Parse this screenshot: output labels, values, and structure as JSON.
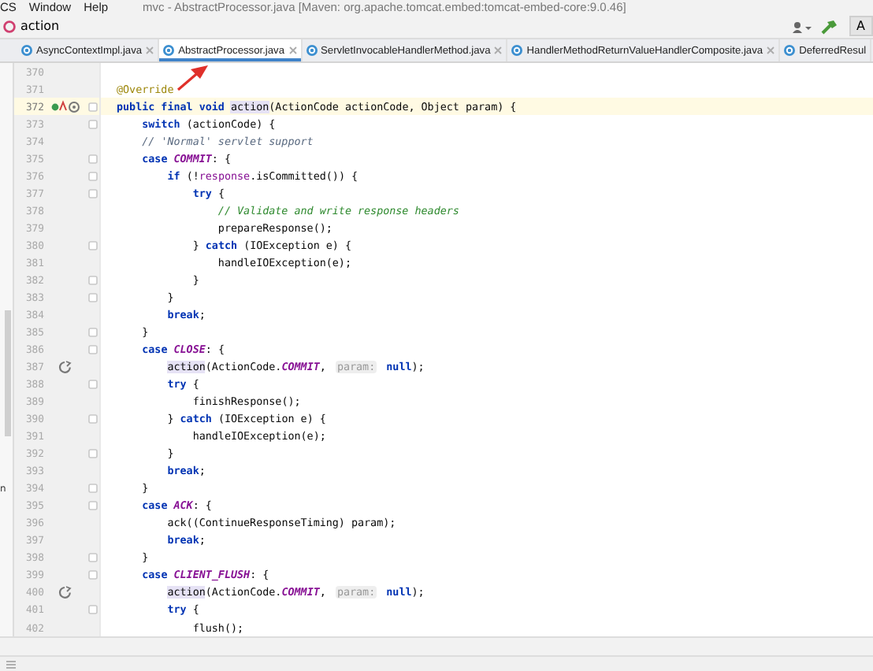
{
  "menu_bar": {
    "items": [
      "CS",
      "Window",
      "Help"
    ],
    "title": "mvc - AbstractProcessor.java [Maven: org.apache.tomcat.embed:tomcat-embed-core:9.0.46]"
  },
  "nav_bar": {
    "breadcrumb": "action",
    "run_button": "A"
  },
  "tabs": [
    {
      "label": "AsyncContextImpl.java",
      "selected": false
    },
    {
      "label": "AbstractProcessor.java",
      "selected": true
    },
    {
      "label": "ServletInvocableHandlerMethod.java",
      "selected": false
    },
    {
      "label": "HandlerMethodReturnValueHandlerComposite.java",
      "selected": false
    },
    {
      "label": "DeferredResul",
      "selected": false
    }
  ],
  "side_panel": {
    "text": "n"
  },
  "editor": {
    "lines": [
      {
        "number": "370",
        "current": false,
        "fold": false
      },
      {
        "number": "371",
        "current": false,
        "fold": false,
        "tokens": [
          {
            "kind": "annotation",
            "text": "@Override"
          }
        ]
      },
      {
        "number": "372",
        "current": true,
        "fold": true,
        "marker": {
          "kind": "override"
        },
        "tokens": [
          {
            "kind": "keyword",
            "text": "public final void "
          },
          {
            "kind": "usage",
            "text": "action"
          },
          {
            "kind": "plain",
            "text": "(ActionCode actionCode, Object param) {"
          }
        ]
      },
      {
        "number": "373",
        "current": false,
        "fold": true,
        "tokens": [
          {
            "kind": "keyword",
            "text": "    switch"
          },
          {
            "kind": "plain",
            "text": " (actionCode) {"
          }
        ]
      },
      {
        "number": "374",
        "current": false,
        "fold": false,
        "tokens": [
          {
            "kind": "comment",
            "text": "    // 'Normal' servlet support"
          }
        ]
      },
      {
        "number": "375",
        "current": false,
        "fold": true,
        "tokens": [
          {
            "kind": "keyword",
            "text": "    case "
          },
          {
            "kind": "constant",
            "text": "COMMIT"
          },
          {
            "kind": "plain",
            "text": ": {"
          }
        ]
      },
      {
        "number": "376",
        "current": false,
        "fold": true,
        "tokens": [
          {
            "kind": "keyword",
            "text": "        if "
          },
          {
            "kind": "plain",
            "text": "(!"
          },
          {
            "kind": "field",
            "text": "response"
          },
          {
            "kind": "plain",
            "text": ".isCommitted()) {"
          }
        ]
      },
      {
        "number": "377",
        "current": false,
        "fold": true,
        "tokens": [
          {
            "kind": "keyword",
            "text": "            try"
          },
          {
            "kind": "plain",
            "text": " {"
          }
        ]
      },
      {
        "number": "378",
        "current": false,
        "fold": false,
        "tokens": [
          {
            "kind": "doc-comment",
            "text": "                // Validate and write response headers"
          }
        ]
      },
      {
        "number": "379",
        "current": false,
        "fold": false,
        "tokens": [
          {
            "kind": "plain",
            "text": "                prepareResponse();"
          }
        ]
      },
      {
        "number": "380",
        "current": false,
        "fold": true,
        "tokens": [
          {
            "kind": "plain",
            "text": "            } "
          },
          {
            "kind": "keyword",
            "text": "catch"
          },
          {
            "kind": "plain",
            "text": " (IOException e) {"
          }
        ]
      },
      {
        "number": "381",
        "current": false,
        "fold": false,
        "tokens": [
          {
            "kind": "plain",
            "text": "                handleIOException(e);"
          }
        ]
      },
      {
        "number": "382",
        "current": false,
        "fold": true,
        "tokens": [
          {
            "kind": "plain",
            "text": "            }"
          }
        ]
      },
      {
        "number": "383",
        "current": false,
        "fold": true,
        "tokens": [
          {
            "kind": "plain",
            "text": "        }"
          }
        ]
      },
      {
        "number": "384",
        "current": false,
        "fold": false,
        "tokens": [
          {
            "kind": "keyword",
            "text": "        break"
          },
          {
            "kind": "plain",
            "text": ";"
          }
        ]
      },
      {
        "number": "385",
        "current": false,
        "fold": true,
        "tokens": [
          {
            "kind": "plain",
            "text": "    }"
          }
        ]
      },
      {
        "number": "386",
        "current": false,
        "fold": true,
        "tokens": [
          {
            "kind": "keyword",
            "text": "    case "
          },
          {
            "kind": "constant",
            "text": "CLOSE"
          },
          {
            "kind": "plain",
            "text": ": {"
          }
        ]
      },
      {
        "number": "387",
        "current": false,
        "fold": false,
        "marker": {
          "kind": "recursion"
        },
        "tokens": [
          {
            "kind": "usage",
            "text": "        action"
          },
          {
            "kind": "plain",
            "text": "(ActionCode."
          },
          {
            "kind": "constant",
            "text": "COMMIT"
          },
          {
            "kind": "plain",
            "text": ", "
          },
          {
            "kind": "hint",
            "text": "param:"
          },
          {
            "kind": "keyword",
            "text": " null"
          },
          {
            "kind": "plain",
            "text": ");"
          }
        ]
      },
      {
        "number": "388",
        "current": false,
        "fold": true,
        "tokens": [
          {
            "kind": "keyword",
            "text": "        try"
          },
          {
            "kind": "plain",
            "text": " {"
          }
        ]
      },
      {
        "number": "389",
        "current": false,
        "fold": false,
        "tokens": [
          {
            "kind": "plain",
            "text": "            finishResponse();"
          }
        ]
      },
      {
        "number": "390",
        "current": false,
        "fold": true,
        "tokens": [
          {
            "kind": "plain",
            "text": "        } "
          },
          {
            "kind": "keyword",
            "text": "catch"
          },
          {
            "kind": "plain",
            "text": " (IOException e) {"
          }
        ]
      },
      {
        "number": "391",
        "current": false,
        "fold": false,
        "tokens": [
          {
            "kind": "plain",
            "text": "            handleIOException(e);"
          }
        ]
      },
      {
        "number": "392",
        "current": false,
        "fold": true,
        "tokens": [
          {
            "kind": "plain",
            "text": "        }"
          }
        ]
      },
      {
        "number": "393",
        "current": false,
        "fold": false,
        "tokens": [
          {
            "kind": "keyword",
            "text": "        break"
          },
          {
            "kind": "plain",
            "text": ";"
          }
        ]
      },
      {
        "number": "394",
        "current": false,
        "fold": true,
        "tokens": [
          {
            "kind": "plain",
            "text": "    }"
          }
        ]
      },
      {
        "number": "395",
        "current": false,
        "fold": true,
        "tokens": [
          {
            "kind": "keyword",
            "text": "    case "
          },
          {
            "kind": "constant",
            "text": "ACK"
          },
          {
            "kind": "plain",
            "text": ": {"
          }
        ]
      },
      {
        "number": "396",
        "current": false,
        "fold": false,
        "tokens": [
          {
            "kind": "plain",
            "text": "        ack((ContinueResponseTiming) param);"
          }
        ]
      },
      {
        "number": "397",
        "current": false,
        "fold": false,
        "tokens": [
          {
            "kind": "keyword",
            "text": "        break"
          },
          {
            "kind": "plain",
            "text": ";"
          }
        ]
      },
      {
        "number": "398",
        "current": false,
        "fold": true,
        "tokens": [
          {
            "kind": "plain",
            "text": "    }"
          }
        ]
      },
      {
        "number": "399",
        "current": false,
        "fold": true,
        "tokens": [
          {
            "kind": "keyword",
            "text": "    case "
          },
          {
            "kind": "constant",
            "text": "CLIENT_FLUSH"
          },
          {
            "kind": "plain",
            "text": ": {"
          }
        ]
      },
      {
        "number": "400",
        "current": false,
        "fold": false,
        "marker": {
          "kind": "recursion"
        },
        "tokens": [
          {
            "kind": "usage",
            "text": "        action"
          },
          {
            "kind": "plain",
            "text": "(ActionCode."
          },
          {
            "kind": "constant",
            "text": "COMMIT"
          },
          {
            "kind": "plain",
            "text": ", "
          },
          {
            "kind": "hint",
            "text": "param:"
          },
          {
            "kind": "keyword",
            "text": " null"
          },
          {
            "kind": "plain",
            "text": ");"
          }
        ]
      },
      {
        "number": "401",
        "current": false,
        "fold": true,
        "tokens": [
          {
            "kind": "keyword",
            "text": "        try"
          },
          {
            "kind": "plain",
            "text": " {"
          }
        ]
      },
      {
        "number": "402",
        "current": false,
        "fold": false,
        "tokens": [
          {
            "kind": "plain",
            "text": "            flush();"
          }
        ]
      }
    ]
  }
}
